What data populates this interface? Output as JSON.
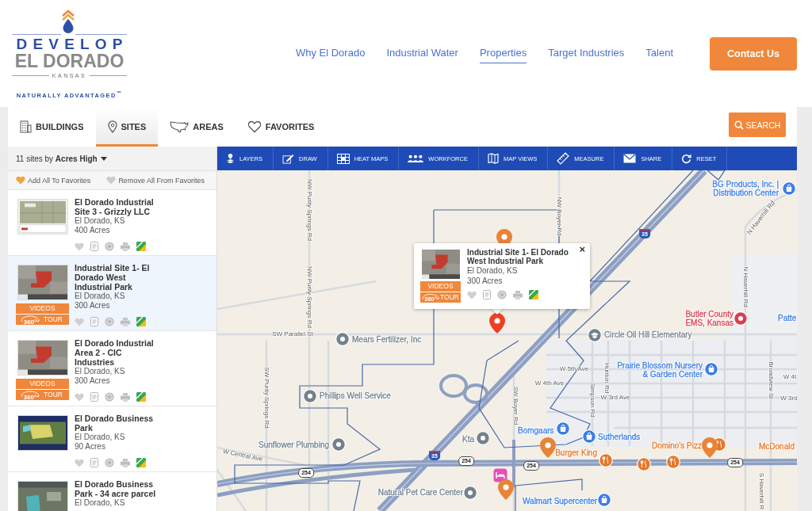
{
  "header": {
    "logo": {
      "top": "DEVELOP",
      "name": "EL DORADO",
      "state": "KANSAS",
      "tagline": "NATURALLY ADVANTAGED$^{™}$"
    },
    "nav": [
      {
        "label": "Why El Dorado",
        "selected": false
      },
      {
        "label": "Industrial Water",
        "selected": false
      },
      {
        "label": "Properties",
        "selected": true
      },
      {
        "label": "Target Industries",
        "selected": false
      },
      {
        "label": "Talent",
        "selected": false
      }
    ],
    "contact_button": "Contact Us"
  },
  "tabs": [
    {
      "label": "BUILDINGS",
      "kind": "building",
      "selected": false
    },
    {
      "label": "SITES",
      "kind": "pin",
      "selected": true
    },
    {
      "label": "AREAS",
      "kind": "map",
      "selected": false
    },
    {
      "label": "FAVORITES",
      "kind": "heart",
      "selected": false
    }
  ],
  "search_button": "SEARCH",
  "sidebar": {
    "sort": "11 sites by **Acres High**",
    "add_all": "Add All To Favorites",
    "remove_all": "Remove All From Favorites",
    "sites": [
      {
        "title": "El Dorado Industrial Site 3 - Grizzly LLC",
        "location": "El Dorado, KS",
        "size": "400 Acres",
        "selected": false,
        "favorite": false
      },
      {
        "title": "Industrial Site 1- El Dorado West Industrial Park",
        "location": "El Dorado, KS",
        "size": "300 Acres",
        "selected": true,
        "favorite": false,
        "videos": "VIDEOS",
        "tour": "TOUR",
        "tour_badge": "360°"
      },
      {
        "title": "El Dorado Industrial Area 2 - CIC Industries",
        "location": "El Dorado, KS",
        "size": "300 Acres",
        "selected": false,
        "favorite": false,
        "videos": "VIDEOS",
        "tour": "TOUR",
        "tour_badge": "360°"
      },
      {
        "title": "El Dorado Business Park",
        "location": "El Dorado, KS",
        "size": "90 Acres",
        "selected": false,
        "favorite": false
      },
      {
        "title": "El Dorado Business Park - 34 acre parcel",
        "location": "El Dorado, KS",
        "selected": false
      }
    ]
  },
  "map": {
    "toolbar": [
      {
        "label": "LAYERS",
        "kind": "layers"
      },
      {
        "label": "DRAW",
        "kind": "draw"
      },
      {
        "label": "HEAT MAPS",
        "kind": "heat"
      },
      {
        "label": "WORKFORCE",
        "kind": "people"
      },
      {
        "label": "MAP VIEWS",
        "kind": "views"
      },
      {
        "label": "MEASURE",
        "kind": "measure"
      },
      {
        "label": "SHARE",
        "kind": "share"
      },
      {
        "label": "RESET",
        "kind": "reset"
      }
    ],
    "roads": [
      "NW Purity Springs Rd",
      "NW Boyer Rd",
      "N Haverhill Rd",
      "NW Purity Springs Rd",
      "N Haverhill Rd",
      "SW Parallel St",
      "W 5th Ave",
      "W 4th Ave",
      "W 3rd Ave",
      "Hunton Rd",
      "Simpson Rd",
      "SW Boyer Rd",
      "Broadview St",
      "W 4t",
      "W 3rd",
      "SW Purity Springs Rd",
      "W Central Ave",
      "S Haverhill R"
    ],
    "shields": [
      {
        "label": "35",
        "kind": "interstate"
      },
      {
        "label": "35",
        "kind": "interstate"
      },
      {
        "label": "254",
        "kind": "us"
      },
      {
        "label": "254",
        "kind": "us"
      },
      {
        "label": "254",
        "kind": "us"
      },
      {
        "label": "254",
        "kind": "us"
      }
    ],
    "places": [
      {
        "name": "BG Products, Inc. | Distribution Center",
        "kind": "shop",
        "color": "#3b7ee8"
      },
      {
        "name": "Butler County EMS, Kansas",
        "kind": "emergency",
        "color": "#d9404f"
      },
      {
        "name": "Patte",
        "color": "#3b7ee8"
      },
      {
        "name": "Mears Fertilizer, Inc",
        "kind": "service",
        "color": "#74828f"
      },
      {
        "name": "Circle Oil Hill Elementary",
        "kind": "school",
        "color": "#74828f"
      },
      {
        "name": "Prairie Blossom Nursery & Garden Center",
        "kind": "shop",
        "color": "#3b7ee8"
      },
      {
        "name": "Phillips Well Service",
        "kind": "service",
        "color": "#74828f"
      },
      {
        "name": "Sunflower Plumbing",
        "kind": "service",
        "color": "#74828f"
      },
      {
        "name": "Kta",
        "kind": "service",
        "color": "#74828f"
      },
      {
        "name": "Bomgaars",
        "kind": "shop",
        "color": "#3b7ee8"
      },
      {
        "name": "Sutherlands",
        "kind": "shop",
        "color": "#3b7ee8"
      },
      {
        "name": "Domino's Pizz",
        "kind": "food",
        "color": "#e8772a"
      },
      {
        "name": "McDonald",
        "color": "#e8772a"
      },
      {
        "name": "Burger King",
        "kind": "food",
        "color": "#e8772a"
      },
      {
        "name": "Natural Pet Care Center",
        "kind": "service",
        "color": "#74828f"
      },
      {
        "name": "Walmart Supercenter",
        "kind": "shop",
        "color": "#3b7ee8"
      }
    ],
    "pins": [
      {
        "selected": false
      },
      {
        "selected": true
      },
      {
        "selected": false
      },
      {
        "selected": false
      },
      {
        "selected": false
      }
    ],
    "popup": {
      "title": "Industrial Site 1- El Dorado West Industrial Park",
      "location": "El Dorado, KS",
      "size": "300 Acres",
      "favorite": false,
      "videos": "VIDEOS",
      "tour": "TOUR",
      "tour_badge": "360°",
      "close": "×"
    }
  }
}
